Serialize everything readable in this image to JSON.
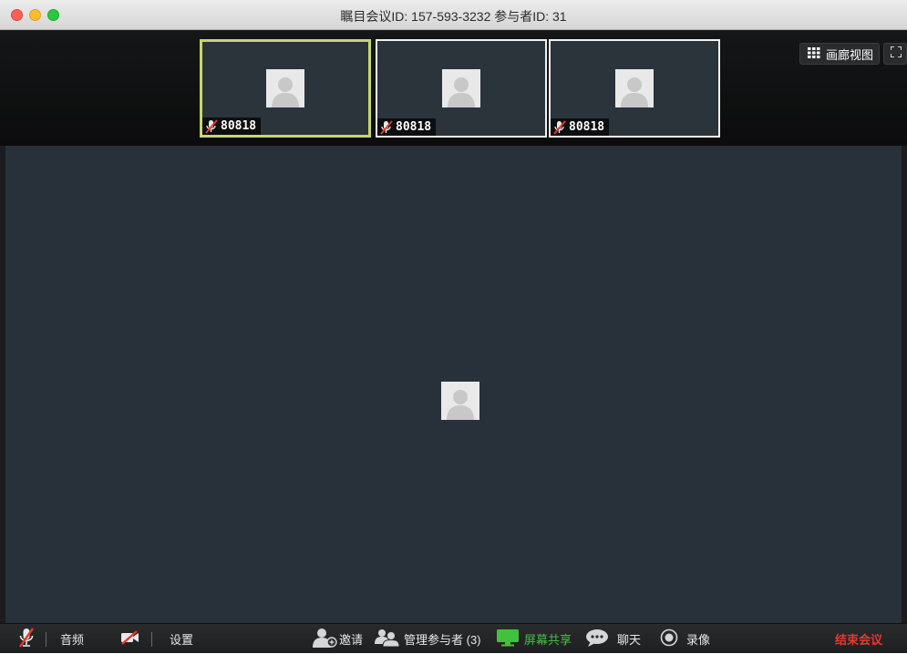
{
  "window": {
    "title": "瞩目会议ID: 157-593-3232 参与者ID: 31"
  },
  "thumbnails": [
    {
      "name": "80818",
      "muted": true,
      "active": true
    },
    {
      "name": "80818",
      "muted": true,
      "active": false
    },
    {
      "name": "80818",
      "muted": true,
      "active": false
    }
  ],
  "view_controls": {
    "gallery_label": "画廊视图"
  },
  "toolbar": {
    "audio_label": "音频",
    "settings_label": "设置",
    "invite_label": "邀请",
    "participants_label": "管理参与者 (3)",
    "share_label": "屏幕共享",
    "chat_label": "聊天",
    "record_label": "录像",
    "end_label": "结束会议"
  },
  "colors": {
    "active_speaker_border": "#c5d672",
    "share_green": "#41c23d",
    "end_red": "#e63a2f",
    "video_bg": "#28313a"
  },
  "icons": {
    "muted_mic": "muted-mic-icon",
    "video_off": "video-off-icon",
    "avatar": "default-avatar-icon",
    "gallery": "grid-icon",
    "fullscreen": "fullscreen-icon",
    "invite": "add-person-icon",
    "participants": "people-icon",
    "share": "monitor-icon",
    "chat": "chat-bubble-icon",
    "record": "record-icon"
  }
}
